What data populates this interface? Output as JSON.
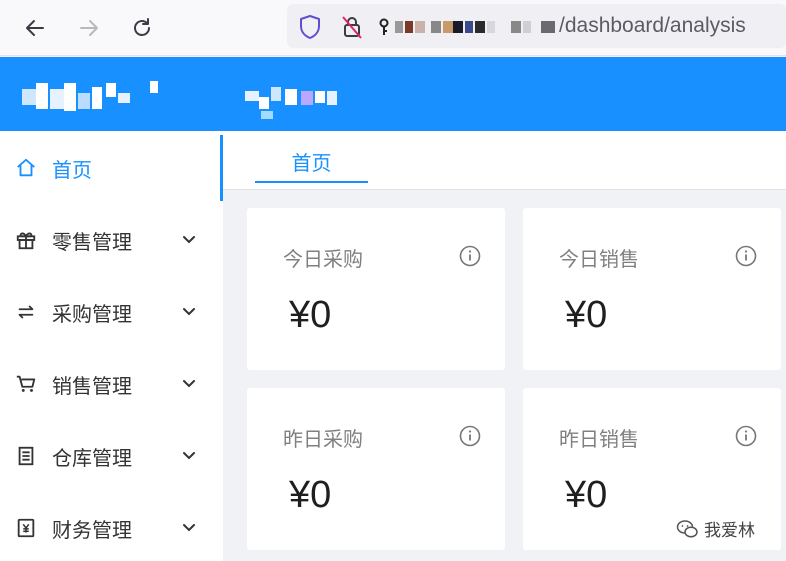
{
  "browser": {
    "url_path": "/dashboard/analysis"
  },
  "header": {
    "app_name_hidden": "",
    "user_hidden": ""
  },
  "sidebar": {
    "items": [
      {
        "label": "首页",
        "icon": "home-icon",
        "active": true
      },
      {
        "label": "零售管理",
        "icon": "gift-icon"
      },
      {
        "label": "采购管理",
        "icon": "swap-icon"
      },
      {
        "label": "销售管理",
        "icon": "cart-icon"
      },
      {
        "label": "仓库管理",
        "icon": "warehouse-icon"
      },
      {
        "label": "财务管理",
        "icon": "finance-icon"
      }
    ]
  },
  "tabs": [
    {
      "label": "首页"
    }
  ],
  "cards": [
    {
      "title": "今日采购",
      "value": "¥0"
    },
    {
      "title": "今日销售",
      "value": "¥0"
    },
    {
      "title": "昨日采购",
      "value": "¥0"
    },
    {
      "title": "昨日销售",
      "value": "¥0"
    }
  ],
  "watermark": "我爱林",
  "colors": {
    "primary": "#1890ff",
    "background": "#f0f2f5"
  }
}
